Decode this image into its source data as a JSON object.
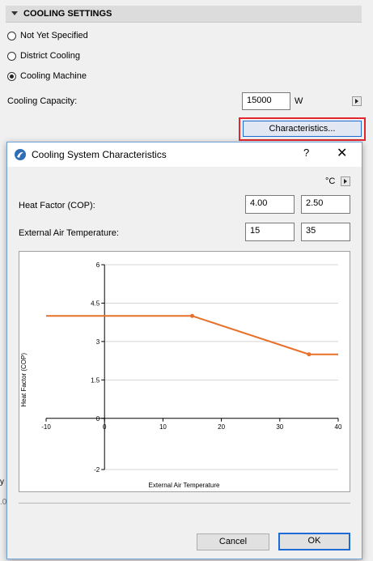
{
  "section": {
    "title": "COOLING SETTINGS"
  },
  "radios": [
    {
      "label": "Not Yet Specified",
      "selected": false
    },
    {
      "label": "District Cooling",
      "selected": false
    },
    {
      "label": "Cooling Machine",
      "selected": true
    }
  ],
  "capacity": {
    "label": "Cooling Capacity:",
    "value": "15000",
    "unit": "W"
  },
  "characteristics_button": "Characteristics...",
  "left_peek": [
    "y",
    ".0"
  ],
  "dialog": {
    "title": "Cooling System Characteristics",
    "help": "?",
    "close": "✕",
    "unit": "°C",
    "heat_factor_label": "Heat Factor (COP):",
    "heat_factor_values": [
      "4.00",
      "2.50"
    ],
    "ext_temp_label": "External Air Temperature:",
    "ext_temp_values": [
      "15",
      "35"
    ],
    "cancel": "Cancel",
    "ok": "OK"
  },
  "chart_data": {
    "type": "line",
    "xlabel": "External Air Temperature",
    "ylabel": "Heat Factor (COP)",
    "xlim": [
      -10,
      40
    ],
    "ylim": [
      -2,
      6
    ],
    "xticks": [
      -10,
      0,
      10,
      20,
      30,
      40
    ],
    "yticks": [
      -2,
      0,
      1.5,
      3,
      4.5,
      6
    ],
    "grid": true,
    "series": [
      {
        "x": [
          -10,
          15,
          35,
          40
        ],
        "y": [
          4.0,
          4.0,
          2.5,
          2.5
        ],
        "markers": [
          15,
          35
        ],
        "color": "#e8702a"
      }
    ]
  },
  "colors": {
    "accent": "#1e6bd6",
    "highlight": "#e3262d",
    "line": "#e8702a"
  }
}
